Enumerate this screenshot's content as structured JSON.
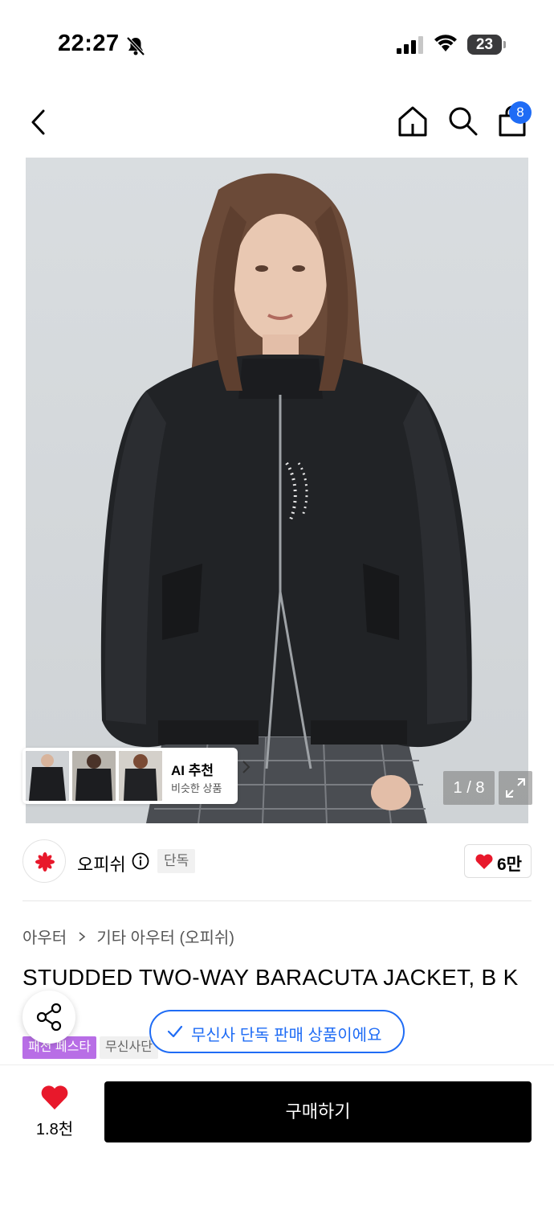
{
  "status_bar": {
    "time": "22:27",
    "battery": "23",
    "icons": [
      "bell-slash-icon",
      "cellular-signal-icon",
      "wifi-icon",
      "battery-icon"
    ]
  },
  "nav": {
    "cart_badge": "8",
    "icons": [
      "chevron-left-icon",
      "home-icon",
      "search-icon",
      "shopping-bag-icon"
    ]
  },
  "gallery": {
    "counter": "1 / 8",
    "ai": {
      "title": "AI 추천",
      "subtitle": "비슷한 상품"
    }
  },
  "brand": {
    "name": "오피쉬",
    "exclusive_tag": "단독",
    "likes": "6만"
  },
  "product": {
    "breadcrumb": [
      "아우터",
      "기타 아우터 (오피쉬)"
    ],
    "title": "STUDDED TWO-WAY BARACUTA JACKET, B  K",
    "tags": [
      "패션 페스타",
      "무신사단"
    ]
  },
  "toast": {
    "text": "무신사 단독 판매 상품이에요"
  },
  "bottom": {
    "wish_count": "1.8천",
    "buy_label": "구매하기"
  },
  "colors": {
    "accent_blue": "#1f6cf5",
    "heart_red": "#e8182b",
    "festa_purple": "#b86ee6",
    "brand_red": "#e8182b"
  }
}
